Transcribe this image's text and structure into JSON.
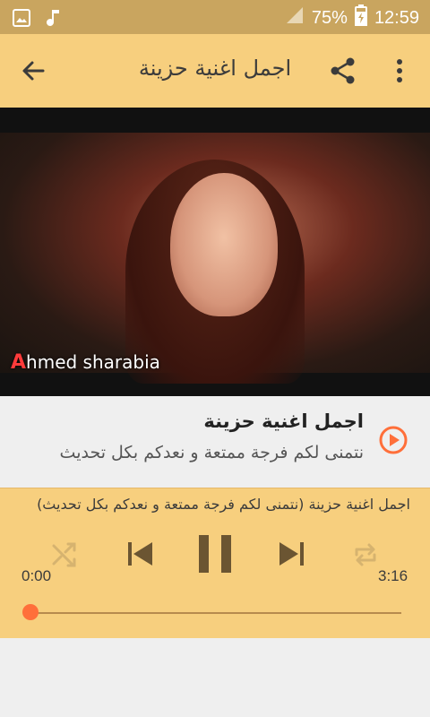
{
  "status_bar": {
    "battery": "75%",
    "time": "12:59",
    "icons": [
      "gallery-icon",
      "music-note-icon",
      "signal-icon",
      "battery-charging-icon"
    ]
  },
  "app_bar": {
    "title": "اجمل اغنية حزينة",
    "icons": [
      "back-arrow-icon",
      "share-icon",
      "more-vertical-icon"
    ]
  },
  "video": {
    "watermark_initial": "A",
    "watermark_text": "hmed sharabia"
  },
  "track": {
    "title": "اجمل اغنية حزينة",
    "description": "نتمنى لكم فرجة ممتعة و نعدكم بكل تحديث"
  },
  "player": {
    "now_playing": "اجمل اغنية حزينة (نتمنى لكم فرجة ممتعة و نعدكم بكل تحديث)",
    "current_time": "0:00",
    "duration": "3:16",
    "progress": 0,
    "controls": [
      "shuffle-icon",
      "skip-previous-icon",
      "pause-icon",
      "skip-next-icon",
      "repeat-icon"
    ]
  },
  "colors": {
    "status_bar": "#c9a55f",
    "app_bar": "#f7cf7e",
    "accent": "#ff6f3a",
    "control": "#6b5532",
    "control_disabled": "#d6b36f"
  }
}
